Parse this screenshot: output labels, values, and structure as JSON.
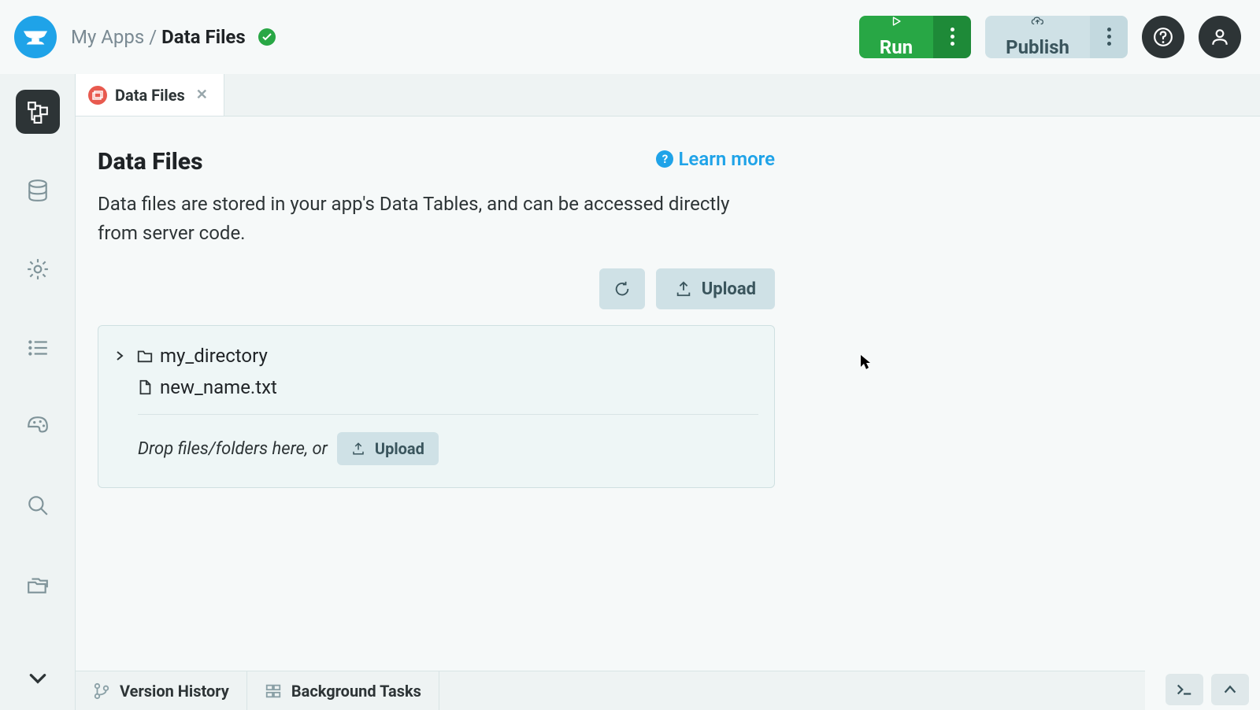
{
  "header": {
    "breadcrumb_root": "My Apps",
    "breadcrumb_sep": "/",
    "breadcrumb_current": "Data Files",
    "run_label": "Run",
    "publish_label": "Publish"
  },
  "tab": {
    "label": "Data Files"
  },
  "panel": {
    "title": "Data Files",
    "learn_more": "Learn more",
    "description": "Data files are stored in your app's Data Tables, and can be accessed directly from server code.",
    "upload_label": "Upload",
    "drop_hint": "Drop files/folders here, or",
    "upload_inline_label": "Upload"
  },
  "files": {
    "dir_name": "my_directory",
    "file_name": "new_name.txt"
  },
  "bottom": {
    "version_history": "Version History",
    "background_tasks": "Background Tasks"
  }
}
